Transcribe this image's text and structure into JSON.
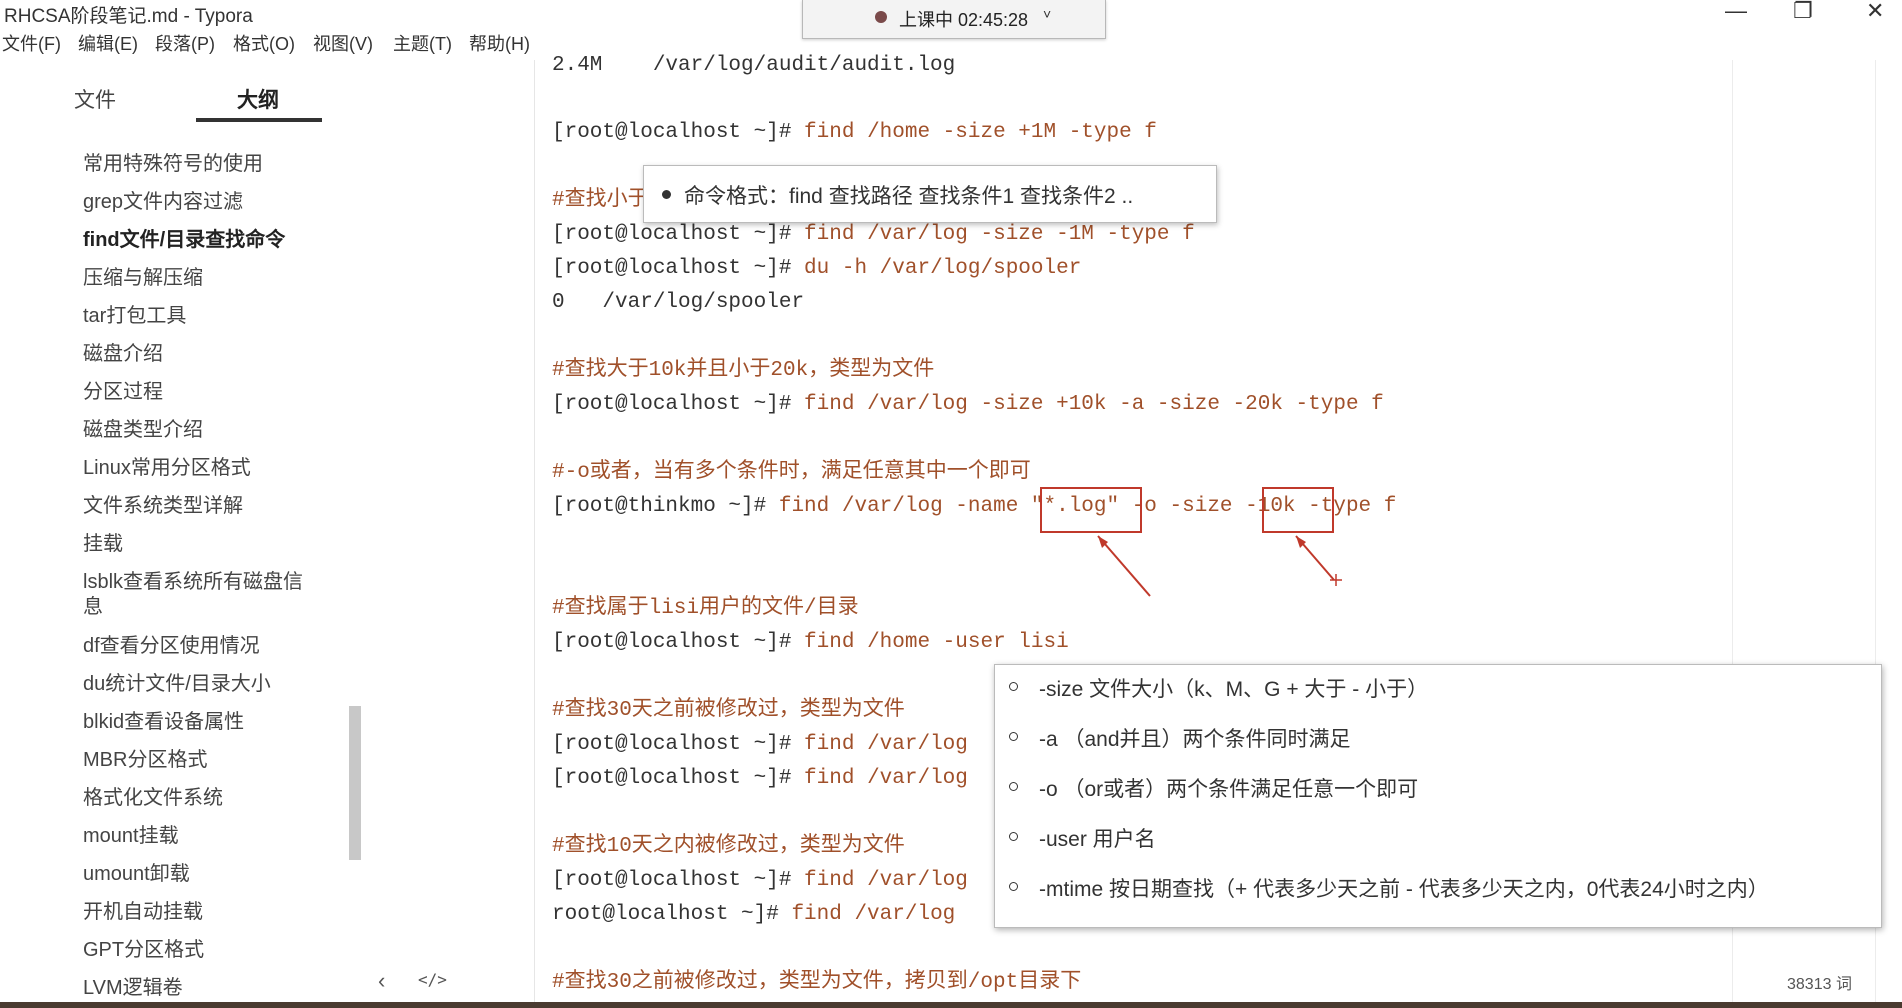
{
  "window": {
    "title": "RHCSA阶段笔记.md - Typora",
    "minimize_icon": "—",
    "maximize_icon": "❐",
    "close_icon": "✕"
  },
  "menu": [
    "文件(F)",
    "编辑(E)",
    "段落(P)",
    "格式(O)",
    "视图(V)",
    "主题(T)",
    "帮助(H)"
  ],
  "recording": {
    "label": "上课中 02:45:28",
    "chevron": "˅"
  },
  "sidebar": {
    "tabs": [
      "文件",
      "大纲"
    ],
    "active_tab": "大纲",
    "outline": [
      "常用特殊符号的使用",
      "grep文件内容过滤",
      "find文件/目录查找命令",
      "压缩与解压缩",
      "tar打包工具",
      "磁盘介绍",
      "分区过程",
      "磁盘类型介绍",
      "Linux常用分区格式",
      "文件系统类型详解",
      "挂载",
      "lsblk查看系统所有磁盘信",
      "息",
      "df查看分区使用情况",
      "du统计文件/目录大小",
      "blkid查看设备属性",
      "MBR分区格式",
      "格式化文件系统",
      "mount挂载",
      "umount卸载",
      "开机自动挂载",
      "GPT分区格式",
      "LVM逻辑卷"
    ],
    "active_item": "find文件/目录查找命令",
    "collapse_icon": "‹",
    "source_icon": "</>"
  },
  "editor": {
    "lines": [
      {
        "type": "out",
        "text": "2.4M    /var/log/audit/audit.log"
      },
      {
        "type": "cmd",
        "prompt": "[root@localhost ~]#",
        "cmd": " find /home -size +1M -type f"
      },
      {
        "type": "comment",
        "text": "#查找小于1M的文件"
      },
      {
        "type": "cmd",
        "prompt": "[root@localhost ~]#",
        "cmd": " find /var/log -size -1M -type f"
      },
      {
        "type": "cmd",
        "prompt": "[root@localhost ~]#",
        "cmd": " du -h /var/log/spooler"
      },
      {
        "type": "out",
        "text": "0   /var/log/spooler"
      },
      {
        "type": "comment",
        "text": "#查找大于10k并且小于20k，类型为文件"
      },
      {
        "type": "cmd",
        "prompt": "[root@localhost ~]#",
        "cmd": " find /var/log -size +10k -a -size -20k -type f"
      },
      {
        "type": "comment",
        "text": "#-o或者，当有多个条件时，满足任意其中一个即可"
      },
      {
        "type": "cmd",
        "prompt": "[root@thinkmo ~]#",
        "cmd": " find /var/log -name \"*.log\" -o -size -10k -type f"
      },
      {
        "type": "comment",
        "text": "#查找属于lisi用户的文件/目录"
      },
      {
        "type": "cmd",
        "prompt": "[root@localhost ~]#",
        "cmd": " find /home -user lisi"
      },
      {
        "type": "comment",
        "text": "#查找30天之前被修改过，类型为文件"
      },
      {
        "type": "cmd",
        "prompt": "[root@localhost ~]#",
        "cmd": " find /var/log"
      },
      {
        "type": "cmd",
        "prompt": "[root@localhost ~]#",
        "cmd": " find /var/log"
      },
      {
        "type": "comment",
        "text": "#查找10天之内被修改过，类型为文件"
      },
      {
        "type": "cmd",
        "prompt": "[root@localhost ~]#",
        "cmd": " find /var/log"
      },
      {
        "type": "cmd",
        "prompt": "root@localhost ~]#",
        "cmd": " find /var/log"
      },
      {
        "type": "comment",
        "text": "#查找30之前被修改过，类型为文件，拷贝到/opt目录下"
      }
    ]
  },
  "tooltip_top": {
    "text": "命令格式：find 查找路径 查找条件1  查找条件2 .."
  },
  "tooltip_options": [
    "-size 文件大小（k、M、G  + 大于  - 小于）",
    "-a （and并且）两个条件同时满足",
    "-o （or或者）两个条件满足任意一个即可",
    "-user 用户名",
    "-mtime 按日期查找（+ 代表多少天之前  - 代表多少天之内，0代表24小时之内）"
  ],
  "status": {
    "word_count": "38313 词"
  },
  "colors": {
    "accent": "#a0502a",
    "highlight_box": "#c0392b"
  }
}
